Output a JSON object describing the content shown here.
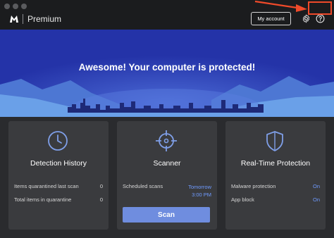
{
  "window": {
    "traffic_lights": [
      "close-button",
      "minimize-button",
      "zoom-button"
    ]
  },
  "header": {
    "logo_icon": "malwarebytes-logo-icon",
    "product_name": "Premium",
    "my_account_label": "My account",
    "settings_icon": "gear-icon",
    "help_icon": "question-icon"
  },
  "hero": {
    "message": "Awesome! Your computer is protected!"
  },
  "cards": [
    {
      "title": "Detection History",
      "icon": "clock-icon",
      "rows": [
        {
          "label": "Items quarantined last scan",
          "value": "0"
        },
        {
          "label": "Total items in quarantine",
          "value": "0"
        }
      ]
    },
    {
      "title": "Scanner",
      "icon": "crosshair-icon",
      "rows": [
        {
          "label": "Scheduled scans",
          "value_line1": "Tomorrow",
          "value_line2": "3:00 PM"
        }
      ],
      "button_label": "Scan"
    },
    {
      "title": "Real-Time Protection",
      "icon": "shield-icon",
      "rows": [
        {
          "label": "Malware protection",
          "value": "On"
        },
        {
          "label": "App block",
          "value": "On"
        }
      ]
    }
  ],
  "colors": {
    "accent_blue": "#6f9bff",
    "scan_button": "#6f8ddf",
    "annotation_red": "#f04a2a",
    "hero_blue": "#2c3bb8"
  }
}
